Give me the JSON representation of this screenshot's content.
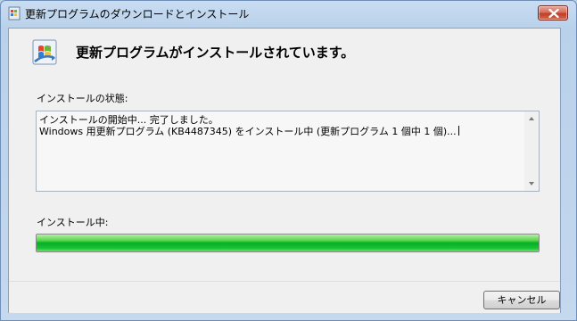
{
  "window": {
    "title": "更新プログラムのダウンロードとインストール"
  },
  "header": {
    "heading": "更新プログラムがインストールされています。",
    "icon": "windows-update-icon"
  },
  "status": {
    "label": "インストールの状態:",
    "log_lines": [
      "インストールの開始中... 完了しました。",
      "Windows 用更新プログラム (KB4487345) をインストール中 (更新プログラム 1 個中 1 個)..."
    ]
  },
  "progress": {
    "label": "インストール中:",
    "fraction": 1.0,
    "color": "#06b025"
  },
  "footer": {
    "cancel_label": "キャンセル"
  },
  "colors": {
    "close_button": "#c13e27",
    "progress_green": "#06b025",
    "client_bg": "#f0f0f0"
  }
}
